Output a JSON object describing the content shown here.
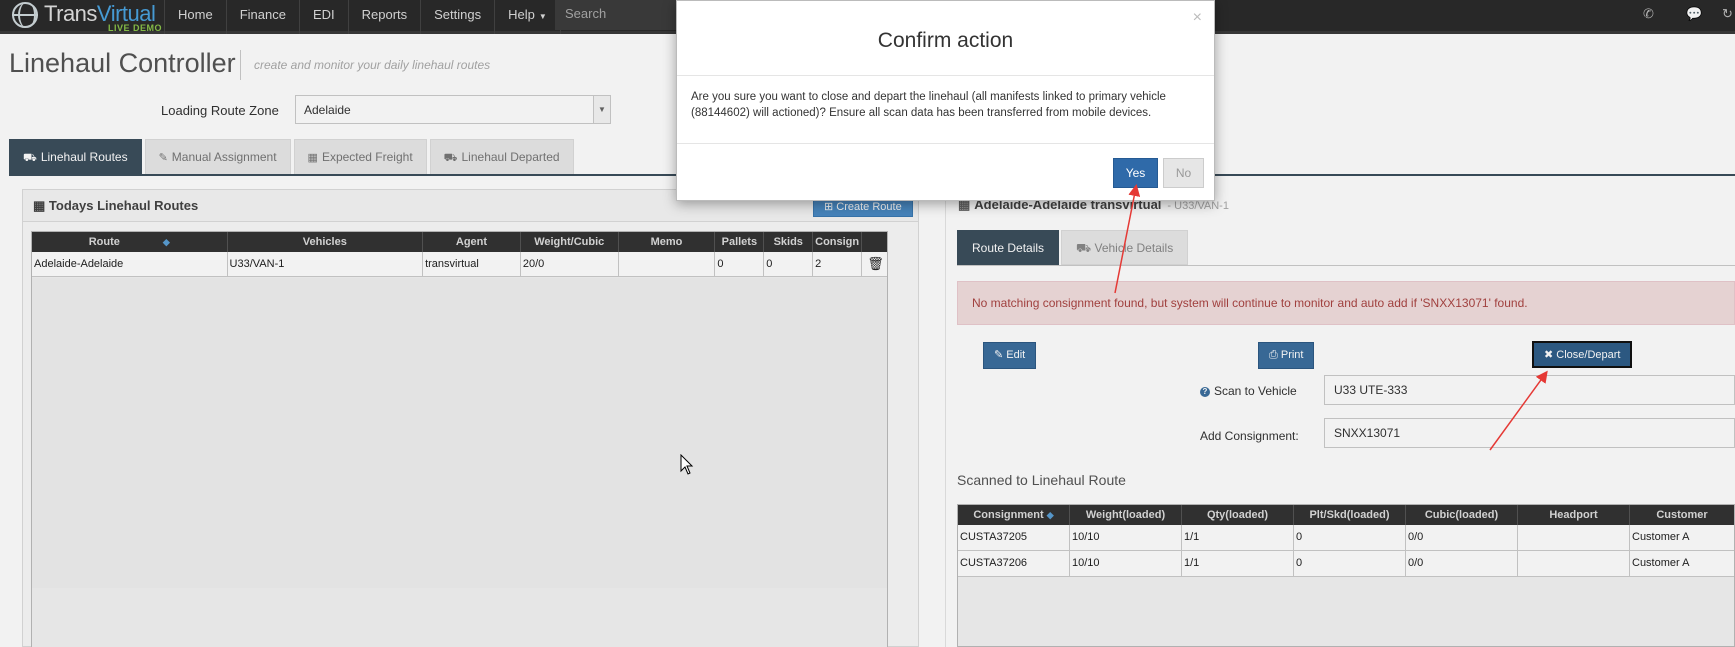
{
  "navbar": {
    "logo_trans": "Trans",
    "logo_virtual": "Virtual",
    "logo_demo": "LIVE DEMO",
    "items": [
      "Home",
      "Finance",
      "EDI",
      "Reports",
      "Settings",
      "Help"
    ],
    "search_placeholder": "Search"
  },
  "page": {
    "title": "Linehaul Controller",
    "subtitle": "create and monitor your daily linehaul routes",
    "zone_label": "Loading Route Zone",
    "zone_value": "Adelaide"
  },
  "tabs": [
    {
      "label": "Linehaul Routes",
      "active": true
    },
    {
      "label": "Manual Assignment"
    },
    {
      "label": "Expected Freight"
    },
    {
      "label": "Linehaul Departed"
    }
  ],
  "left_panel": {
    "title": "Todays Linehaul Routes",
    "create_button": "Create Route",
    "columns": [
      "Route",
      "Vehicles",
      "Agent",
      "Weight/Cubic",
      "Memo",
      "Pallets",
      "Skids",
      "Consign"
    ],
    "rows": [
      [
        "Adelaide-Adelaide",
        "U33/VAN-1",
        "transvirtual",
        "20/0",
        "",
        "0",
        "0",
        "2"
      ]
    ]
  },
  "right_panel": {
    "title": "Adelaide-Adelaide transvirtual",
    "title_sub": "- U33/VAN-1",
    "tabs": [
      "Route Details",
      "Vehicle Details"
    ],
    "alert": "No matching consignment found, but system will continue to monitor and auto add if 'SNXX13071' found.",
    "edit_button": "Edit",
    "print_button": "Print",
    "close_depart_button": "Close/Depart",
    "scan_label": "Scan to Vehicle",
    "scan_value": "U33 UTE-333",
    "add_label": "Add Consignment:",
    "add_value": "SNXX13071",
    "section_title": "Scanned to Linehaul Route",
    "columns": [
      "Consignment",
      "Weight(loaded)",
      "Qty(loaded)",
      "Plt/Skd(loaded)",
      "Cubic(loaded)",
      "Headport",
      "Customer"
    ],
    "rows": [
      [
        "CUSTA37205",
        "10/10",
        "1/1",
        "0",
        "0/0",
        "",
        "Customer A"
      ],
      [
        "CUSTA37206",
        "10/10",
        "1/1",
        "0",
        "0/0",
        "",
        "Customer A"
      ]
    ]
  },
  "modal": {
    "title": "Confirm action",
    "body": "Are you sure you want to close and depart the linehaul (all manifests linked to primary vehicle (88144602) will actioned)? Ensure all scan data has been transferred from mobile devices.",
    "yes": "Yes",
    "no": "No",
    "close": "×"
  },
  "colors": {
    "accent": "#3c4e5c",
    "primary": "#2f6aa9",
    "alert_bg": "#f2dede",
    "alert_text": "#a94442",
    "annotation": "#e53935"
  }
}
